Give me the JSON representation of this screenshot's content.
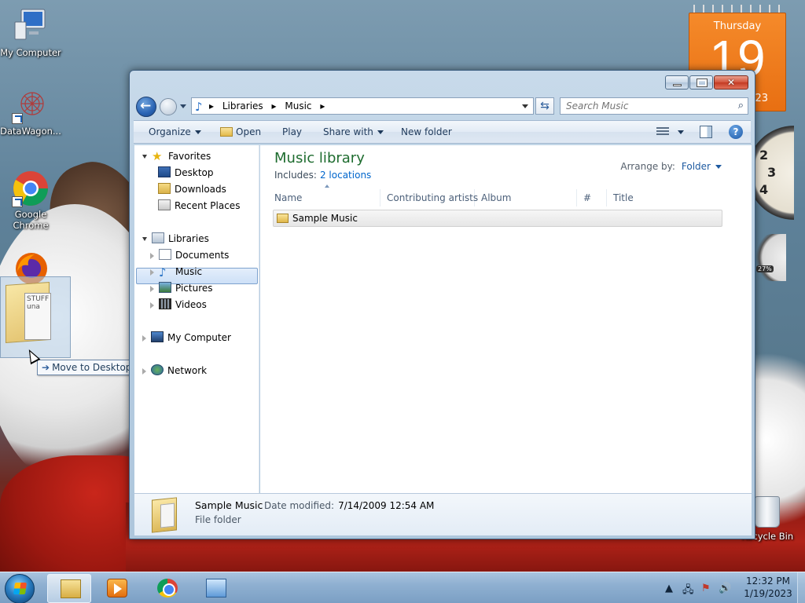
{
  "desktop": {
    "icons": [
      {
        "label": "My Computer"
      },
      {
        "label": "DataWagon..."
      },
      {
        "label": "Google Chrome"
      },
      {
        "label": "Recycle Bin"
      }
    ],
    "drag_tooltip": "Move to Desktop",
    "drag_paper_text": "STUFF una"
  },
  "calendar": {
    "weekday": "Thursday",
    "day": "19",
    "year_suffix": "23"
  },
  "clock_gadget": {
    "numbers": [
      "2",
      "3",
      "4"
    ]
  },
  "meter_gadget": {
    "value": "27%"
  },
  "window": {
    "address": {
      "crumbs": [
        "Libraries",
        "Music"
      ]
    },
    "search": {
      "placeholder": "Search Music"
    },
    "command_bar": {
      "organize": "Organize",
      "open": "Open",
      "play": "Play",
      "share_with": "Share with",
      "new_folder": "New folder"
    },
    "nav": {
      "favorites": "Favorites",
      "desktop": "Desktop",
      "downloads": "Downloads",
      "recent_places": "Recent Places",
      "libraries": "Libraries",
      "documents": "Documents",
      "music": "Music",
      "pictures": "Pictures",
      "videos": "Videos",
      "my_computer": "My Computer",
      "network": "Network"
    },
    "content": {
      "title": "Music library",
      "includes_label": "Includes:",
      "includes_link": "2 locations",
      "arrange_label": "Arrange by:",
      "arrange_value": "Folder",
      "columns": [
        "Name",
        "Contributing artists",
        "Album",
        "#",
        "Title"
      ],
      "items": [
        {
          "name": "Sample Music"
        }
      ]
    },
    "details": {
      "name": "Sample Music",
      "modified_label": "Date modified:",
      "modified_value": "7/14/2009 12:54 AM",
      "type": "File folder"
    }
  },
  "taskbar": {
    "time": "12:32 PM",
    "date": "1/19/2023"
  },
  "colors": {
    "library_title": "#1e6c2f",
    "link": "#0066cc",
    "calendar_orange": "#e86f12",
    "close_button": "#c33a22"
  }
}
